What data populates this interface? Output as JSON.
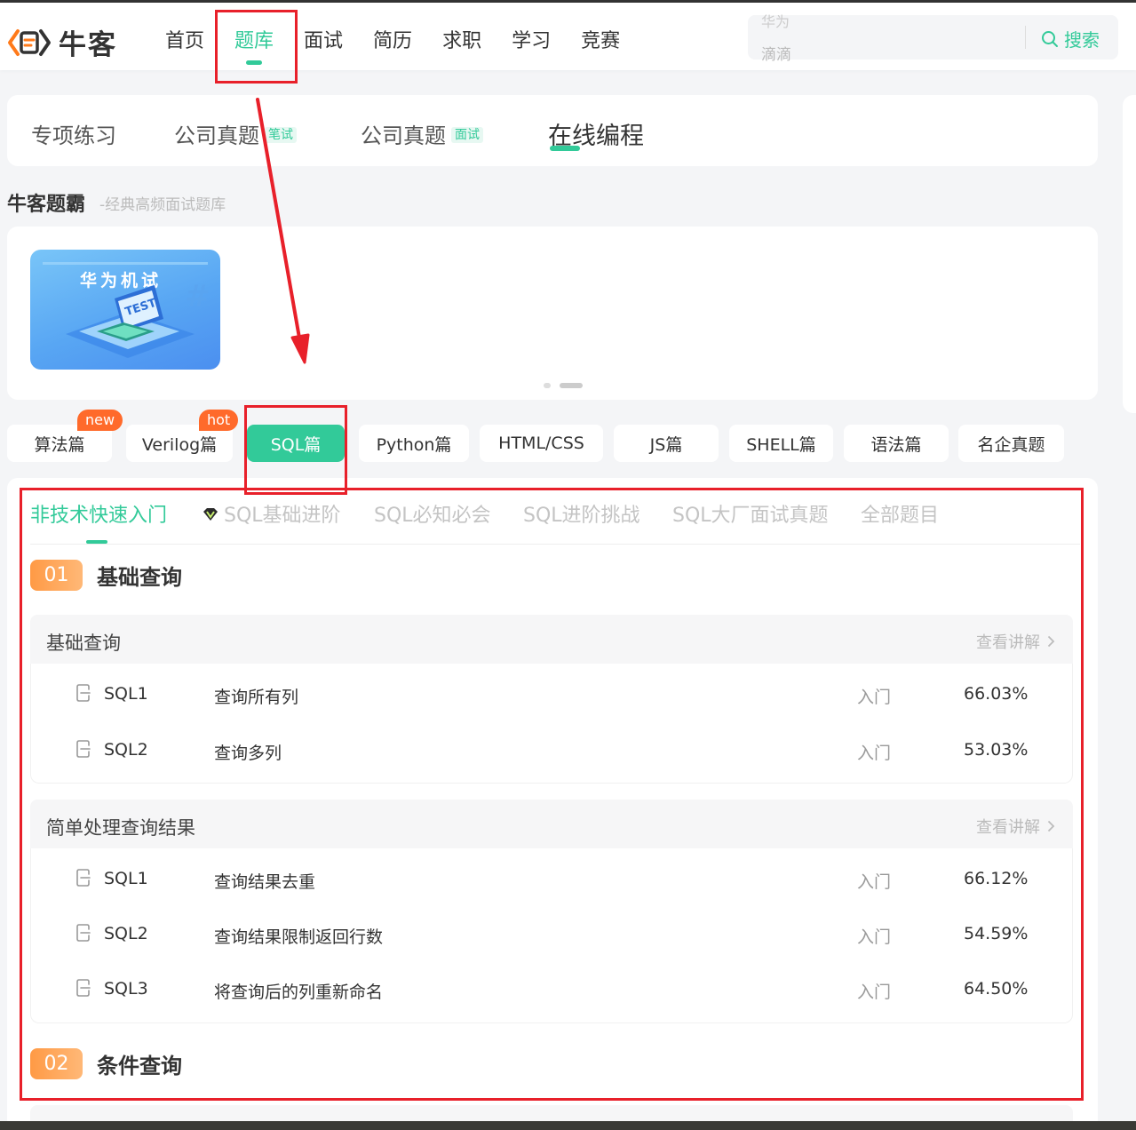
{
  "header": {
    "logo_text": "牛客",
    "nav": [
      "首页",
      "题库",
      "面试",
      "简历",
      "求职",
      "学习",
      "竞赛"
    ],
    "active_nav": "题库",
    "search_placeholder": "滴滴",
    "search_placeholder_top": "华为",
    "search_button": "搜索"
  },
  "practice_tabs": [
    {
      "label": "专项练习",
      "badge": ""
    },
    {
      "label": "公司真题",
      "badge": "笔试"
    },
    {
      "label": "公司真题",
      "badge": "面试"
    },
    {
      "label": "在线编程",
      "badge": ""
    }
  ],
  "section": {
    "title": "牛客题霸",
    "subtitle": "-经典高频面试题库"
  },
  "banner": {
    "label": "华为机试"
  },
  "categories": [
    {
      "label": "算法篇",
      "tag": "new"
    },
    {
      "label": "Verilog篇",
      "tag": "hot"
    },
    {
      "label": "SQL篇",
      "tag": ""
    },
    {
      "label": "Python篇",
      "tag": ""
    },
    {
      "label": "HTML/CSS",
      "tag": ""
    },
    {
      "label": "JS篇",
      "tag": ""
    },
    {
      "label": "SHELL篇",
      "tag": ""
    },
    {
      "label": "语法篇",
      "tag": ""
    },
    {
      "label": "名企真题",
      "tag": ""
    }
  ],
  "sub_tabs": [
    "非技术快速入门",
    "SQL基础进阶",
    "SQL必知必会",
    "SQL进阶挑战",
    "SQL大厂面试真题",
    "全部题目"
  ],
  "chapters": [
    {
      "num": "01",
      "title": "基础查询"
    },
    {
      "num": "02",
      "title": "条件查询"
    }
  ],
  "groups": [
    {
      "title": "基础查询",
      "link": "查看讲解",
      "rows": [
        {
          "id": "SQL1",
          "name": "查询所有列",
          "level": "入门",
          "rate": "66.03%"
        },
        {
          "id": "SQL2",
          "name": "查询多列",
          "level": "入门",
          "rate": "53.03%"
        }
      ]
    },
    {
      "title": "简单处理查询结果",
      "link": "查看讲解",
      "rows": [
        {
          "id": "SQL1",
          "name": "查询结果去重",
          "level": "入门",
          "rate": "66.12%"
        },
        {
          "id": "SQL2",
          "name": "查询结果限制返回行数",
          "level": "入门",
          "rate": "54.59%"
        },
        {
          "id": "SQL3",
          "name": "将查询后的列重新命名",
          "level": "入门",
          "rate": "64.50%"
        }
      ]
    }
  ],
  "colors": {
    "accent": "#32ca99",
    "annotation": "#e8202a",
    "tag": "#ff6a2b",
    "chapter": "#ff9a45"
  }
}
